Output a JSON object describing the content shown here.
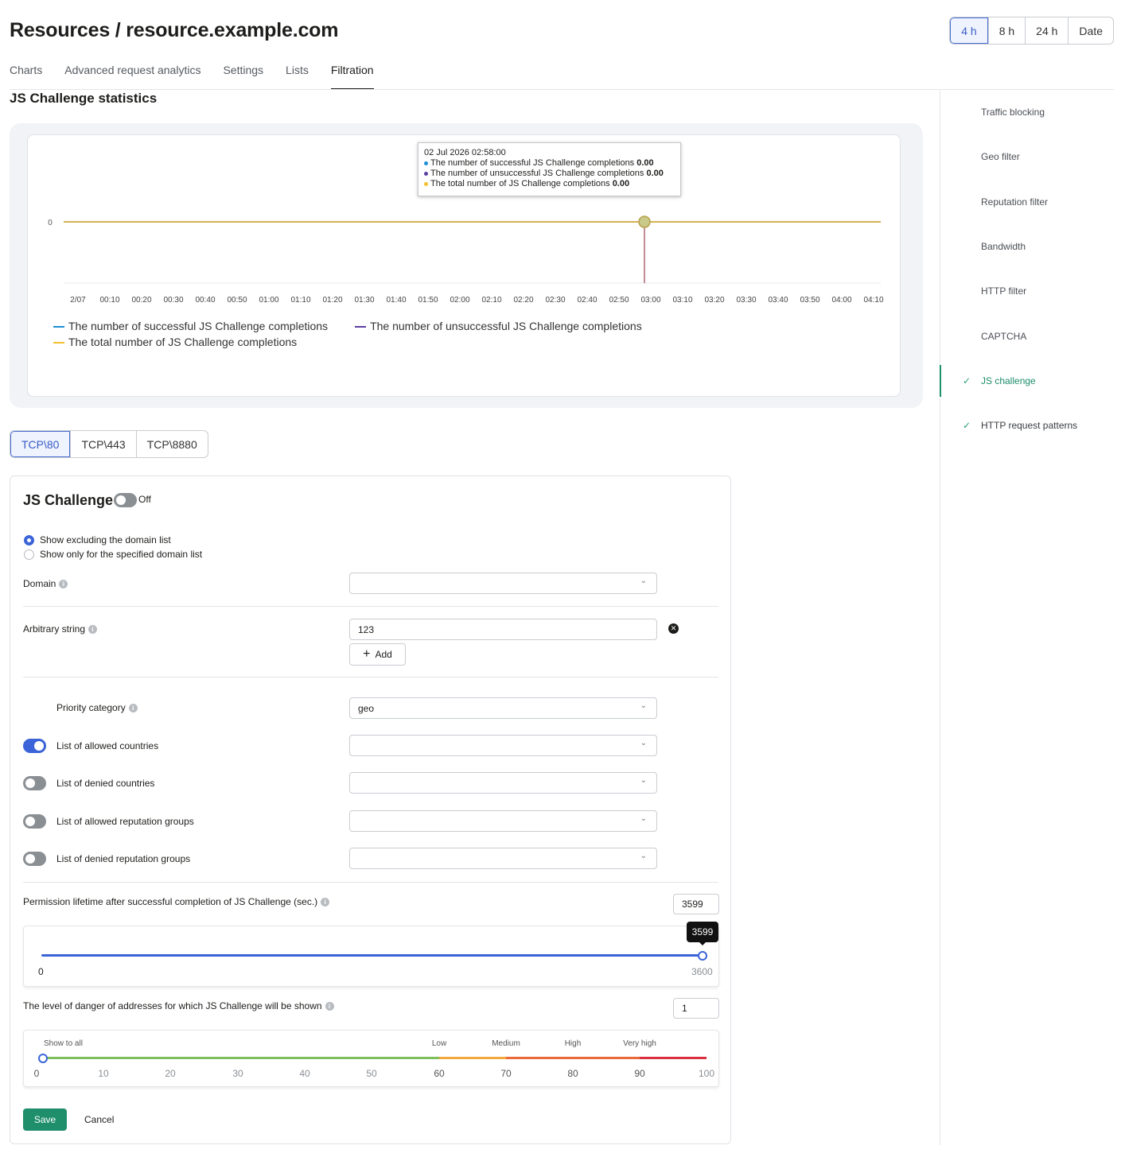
{
  "header": {
    "title": "Resources / resource.example.com"
  },
  "time_range": {
    "options": [
      "4 h",
      "8 h",
      "24 h",
      "Date"
    ],
    "selected": "4 h"
  },
  "tabs": [
    {
      "label": "Charts"
    },
    {
      "label": "Advanced request analytics"
    },
    {
      "label": "Settings"
    },
    {
      "label": "Lists"
    },
    {
      "label": "Filtration"
    }
  ],
  "active_tab": "Filtration",
  "side_nav": [
    {
      "label": "Traffic blocking"
    },
    {
      "label": "Geo filter"
    },
    {
      "label": "Reputation filter"
    },
    {
      "label": "Bandwidth"
    },
    {
      "label": "HTTP filter"
    },
    {
      "label": "CAPTCHA"
    },
    {
      "label": "JS challenge"
    },
    {
      "label": "HTTP request patterns"
    }
  ],
  "section": {
    "title": "JS Challenge statistics"
  },
  "chart_data": {
    "type": "line",
    "x": [
      "2/07",
      "00:10",
      "00:20",
      "00:30",
      "00:40",
      "00:50",
      "01:00",
      "01:10",
      "01:20",
      "01:30",
      "01:40",
      "01:50",
      "02:00",
      "02:10",
      "02:20",
      "02:30",
      "02:40",
      "02:50",
      "03:00",
      "03:10",
      "03:20",
      "03:30",
      "03:40",
      "03:50",
      "04:00",
      "04:10"
    ],
    "y_ticks": [
      "0"
    ],
    "series": [
      {
        "name": "The number of successful JS Challenge completions",
        "color": "#1f8fd6",
        "values": [
          0,
          0,
          0,
          0,
          0,
          0,
          0,
          0,
          0,
          0,
          0,
          0,
          0,
          0,
          0,
          0,
          0,
          0,
          0,
          0,
          0,
          0,
          0,
          0,
          0,
          0
        ]
      },
      {
        "name": "The number of unsuccessful JS Challenge completions",
        "color": "#5b3fa0",
        "values": [
          0,
          0,
          0,
          0,
          0,
          0,
          0,
          0,
          0,
          0,
          0,
          0,
          0,
          0,
          0,
          0,
          0,
          0,
          0,
          0,
          0,
          0,
          0,
          0,
          0,
          0
        ]
      },
      {
        "name": "The total number of JS Challenge completions",
        "color": "#f2c12e",
        "values": [
          0,
          0,
          0,
          0,
          0,
          0,
          0,
          0,
          0,
          0,
          0,
          0,
          0,
          0,
          0,
          0,
          0,
          0,
          0,
          0,
          0,
          0,
          0,
          0,
          0,
          0
        ]
      }
    ],
    "tooltip": {
      "date": "02 Jul 2026 02:58:00",
      "rows": [
        {
          "label": "The number of successful JS Challenge completions",
          "value": "0.00",
          "color": "#1f8fd6"
        },
        {
          "label": "The number of unsuccessful JS Challenge completions",
          "value": "0.00",
          "color": "#5b3fa0"
        },
        {
          "label": "The total number of JS Challenge completions",
          "value": "0.00",
          "color": "#f2c12e"
        }
      ]
    },
    "crosshair_x": "02:58",
    "legend_position": "bottom-left"
  },
  "ports": {
    "options": [
      "TCP\\80",
      "TCP\\443",
      "TCP\\8880"
    ],
    "selected": "TCP\\80"
  },
  "form": {
    "title": "JS Challenge",
    "toggle_state": "Off",
    "radio_options": [
      {
        "label": "Show excluding the domain list",
        "checked": true
      },
      {
        "label": "Show only for the specified domain list",
        "checked": false
      }
    ],
    "domain_label": "Domain",
    "domain_value": "",
    "arbitrary_label": "Arbitrary string",
    "arbitrary_value": "123",
    "add_label": "Add",
    "priority_label": "Priority category",
    "priority_value": "geo",
    "lists": [
      {
        "label": "List of allowed countries",
        "enabled": true,
        "value": ""
      },
      {
        "label": "List of denied countries",
        "enabled": false,
        "value": ""
      },
      {
        "label": "List of allowed reputation groups",
        "enabled": false,
        "value": ""
      },
      {
        "label": "List of denied reputation groups",
        "enabled": false,
        "value": ""
      }
    ],
    "lifetime_label": "Permission lifetime after successful completion of JS Challenge (sec.)",
    "lifetime_value": "3599",
    "lifetime_slider": {
      "min": "0",
      "max": "3600",
      "value": 3599,
      "tooltip": "3599"
    },
    "danger_label": "The level of danger of addresses for which JS Challenge will be shown",
    "danger_value": "1",
    "danger_slider": {
      "value": 1,
      "ticks": [
        "0",
        "10",
        "20",
        "30",
        "40",
        "50",
        "60",
        "70",
        "80",
        "90",
        "100"
      ],
      "levels": [
        {
          "label": "Show to all",
          "at": 0
        },
        {
          "label": "Low",
          "at": 60
        },
        {
          "label": "Medium",
          "at": 70
        },
        {
          "label": "High",
          "at": 80
        },
        {
          "label": "Very high",
          "at": 90
        }
      ],
      "colors": {
        "green": "#7cbf5c",
        "orange": "#f0a93a",
        "red_orange": "#ec6a3a",
        "red": "#d9303f"
      }
    },
    "save_label": "Save",
    "cancel_label": "Cancel"
  }
}
